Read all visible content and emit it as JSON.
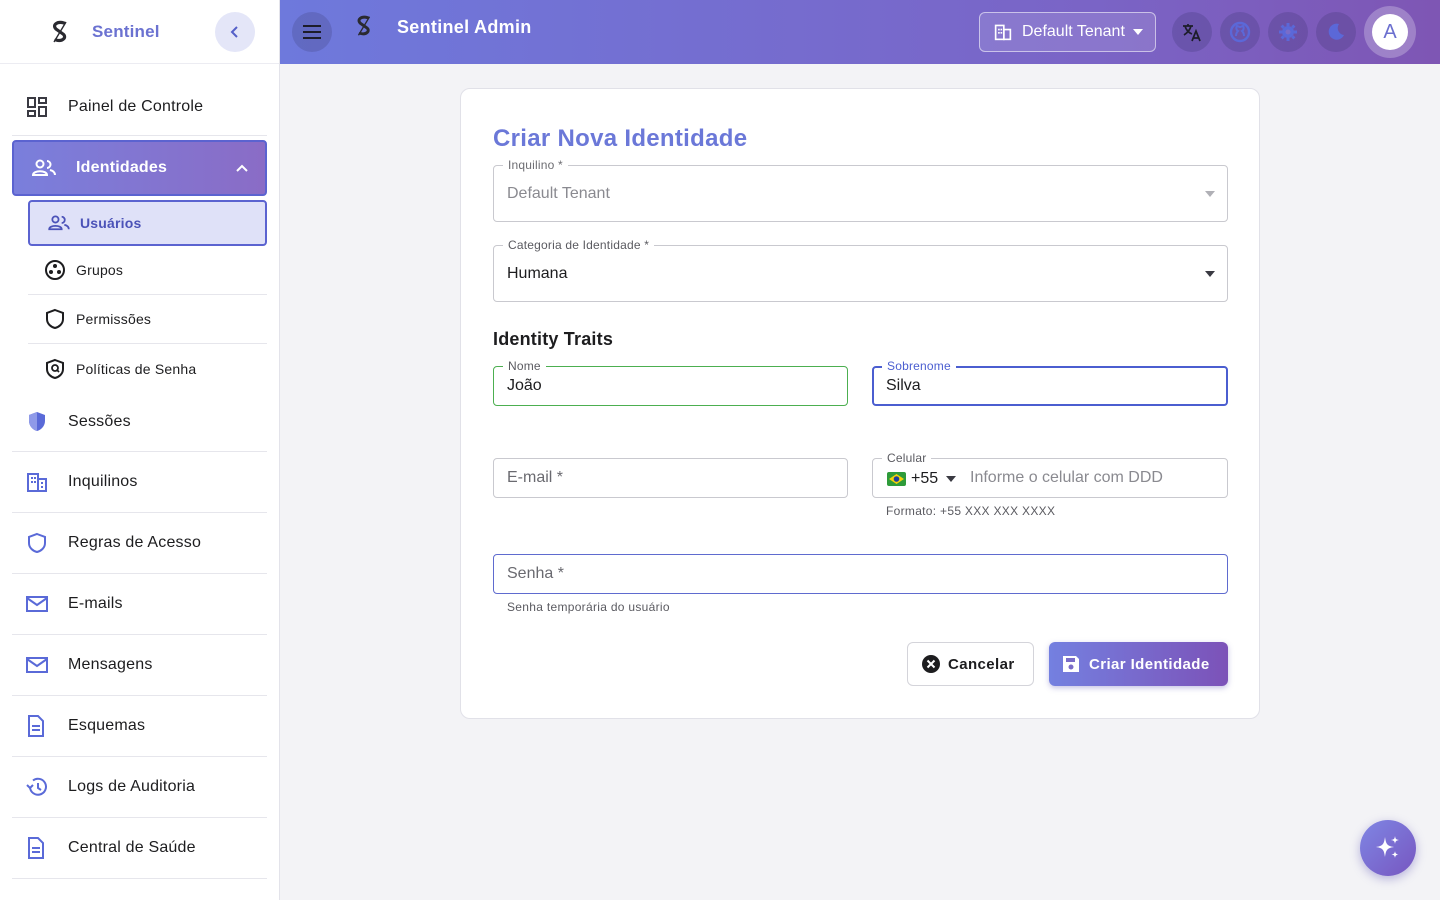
{
  "sidebar": {
    "brand": "Sentinel",
    "items": [
      {
        "label": "Painel de Controle",
        "icon": "dashboard-icon"
      },
      {
        "label": "Identidades",
        "icon": "people-icon",
        "active": true,
        "children": [
          {
            "label": "Usuários",
            "icon": "people-icon",
            "active": true
          },
          {
            "label": "Grupos",
            "icon": "groups-icon"
          },
          {
            "label": "Permissões",
            "icon": "shield-icon"
          },
          {
            "label": "Políticas de Senha",
            "icon": "policy-icon"
          }
        ]
      },
      {
        "label": "Sessões",
        "icon": "security-shield-icon"
      },
      {
        "label": "Inquilinos",
        "icon": "buildings-icon"
      },
      {
        "label": "Regras de Acesso",
        "icon": "shield-outline-icon"
      },
      {
        "label": "E-mails",
        "icon": "mail-icon"
      },
      {
        "label": "Mensagens",
        "icon": "mail-icon"
      },
      {
        "label": "Esquemas",
        "icon": "document-icon"
      },
      {
        "label": "Logs de Auditoria",
        "icon": "history-icon"
      },
      {
        "label": "Central de Saúde",
        "icon": "document-icon"
      }
    ]
  },
  "header": {
    "title": "Sentinel Admin",
    "tenant": "Default Tenant",
    "avatar_initial": "A"
  },
  "form": {
    "title": "Criar Nova Identidade",
    "tenant": {
      "label": "Inquilino *",
      "value": "Default Tenant"
    },
    "category": {
      "label": "Categoria de Identidade *",
      "value": "Humana"
    },
    "traits_heading": "Identity Traits",
    "first_name": {
      "label": "Nome",
      "value": "João"
    },
    "last_name": {
      "label": "Sobrenome",
      "value": "Silva"
    },
    "email": {
      "placeholder": "E-mail *"
    },
    "phone": {
      "label": "Celular",
      "country_code": "+55",
      "placeholder": "Informe o celular com DDD",
      "helper": "Formato: +55 XXX XXX XXXX"
    },
    "password": {
      "placeholder": "Senha *",
      "helper": "Senha temporária do usuário"
    },
    "cancel_label": "Cancelar",
    "submit_label": "Criar Identidade"
  },
  "colors": {
    "accent": "#6b78d8",
    "gradient_end": "#7c52b8",
    "valid": "#4caf50"
  }
}
